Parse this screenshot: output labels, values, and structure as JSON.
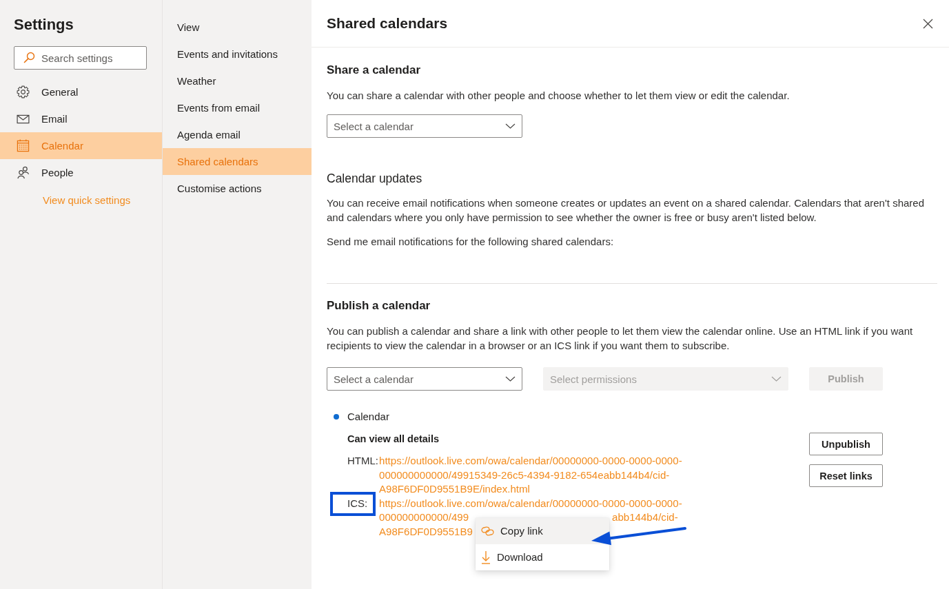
{
  "settings_sidebar": {
    "title": "Settings",
    "search": {
      "placeholder": "Search settings"
    },
    "items": [
      {
        "label": "General",
        "selected": false
      },
      {
        "label": "Email",
        "selected": false
      },
      {
        "label": "Calendar",
        "selected": true
      },
      {
        "label": "People",
        "selected": false
      }
    ],
    "quick_settings_link": "View quick settings"
  },
  "calendar_menu": {
    "items": [
      {
        "label": "View",
        "selected": false
      },
      {
        "label": "Events and invitations",
        "selected": false
      },
      {
        "label": "Weather",
        "selected": false
      },
      {
        "label": "Events from email",
        "selected": false
      },
      {
        "label": "Agenda email",
        "selected": false
      },
      {
        "label": "Shared calendars",
        "selected": true
      },
      {
        "label": "Customise actions",
        "selected": false
      }
    ]
  },
  "panel": {
    "title": "Shared calendars",
    "share_section": {
      "heading": "Share a calendar",
      "description": "You can share a calendar with other people and choose whether to let them view or edit the calendar.",
      "calendar_select": {
        "placeholder": "Select a calendar",
        "disabled": false
      }
    },
    "updates_section": {
      "heading": "Calendar updates",
      "description": "You can receive email notifications when someone creates or updates an event on a shared calendar. Calendars that aren't shared and calendars where you only have permission to see whether the owner is free or busy aren't listed below.",
      "prompt": "Send me email notifications for the following shared calendars:"
    },
    "publish_section": {
      "heading": "Publish a calendar",
      "description": "You can publish a calendar and share a link with other people to let them view the calendar online. Use an HTML link if you want recipients to view the calendar in a browser or an ICS link if you want them to subscribe.",
      "calendar_select": {
        "placeholder": "Select a calendar",
        "disabled": false
      },
      "permissions_select": {
        "placeholder": "Select permissions",
        "disabled": true
      },
      "publish_button": {
        "label": "Publish",
        "disabled": true
      },
      "published_calendars": [
        {
          "name": "Calendar",
          "color": "#0f6cd0",
          "permission": "Can view all details",
          "links": [
            {
              "label": "HTML:",
              "framed": false,
              "lines": [
                [
                  "https://outlook.live.com/owa/calendar/00000000-0000-0000-0000-"
                ],
                [
                  "000000000000/49915349-26c5-4394-9182-654eabb144b4/cid-"
                ],
                [
                  "A98F6DF0D9551B9E/index.html"
                ]
              ]
            },
            {
              "label": "ICS:",
              "framed": true,
              "lines": [
                [
                  "https://outlook.live.com/owa/calendar/00000000-0000-0000-0000-"
                ],
                [
                  "000000000000/499",
                  "abb144b4/cid-"
                ],
                [
                  "A98F6DF0D9551B9"
                ]
              ],
              "context_menu": [
                {
                  "label": "Copy link",
                  "highlighted": true
                },
                {
                  "label": "Download",
                  "highlighted": false
                }
              ]
            }
          ],
          "buttons": [
            {
              "label": "Unpublish",
              "disabled": false
            },
            {
              "label": "Reset links",
              "disabled": false
            }
          ]
        }
      ]
    }
  }
}
